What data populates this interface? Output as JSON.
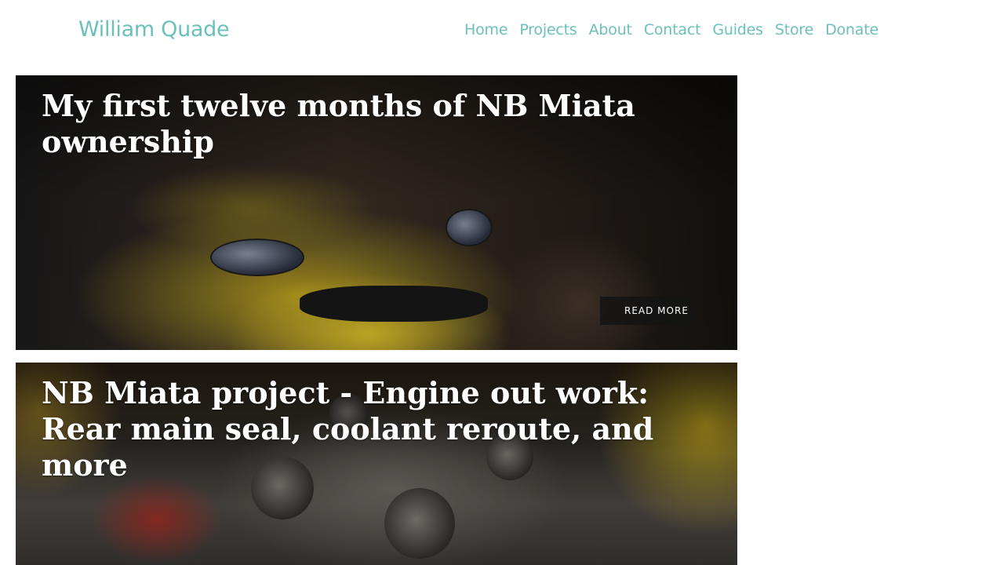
{
  "header": {
    "site_title": "William Quade",
    "nav": [
      "Home",
      "Projects",
      "About",
      "Contact",
      "Guides",
      "Store",
      "Donate"
    ]
  },
  "posts": [
    {
      "title": "My first twelve months of NB Miata ownership",
      "read_more": "READ MORE"
    },
    {
      "title": "NB Miata project - Engine out work: Rear main seal, coolant reroute, and more"
    }
  ],
  "colors": {
    "accent": "#6cc0bb",
    "title_text": "#ffffff"
  }
}
